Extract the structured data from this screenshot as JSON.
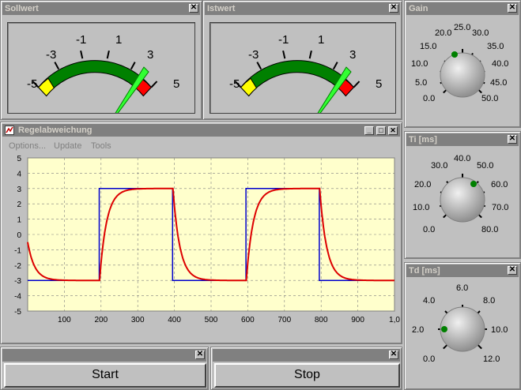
{
  "sollwert": {
    "title": "Sollwert",
    "ticks": [
      "-5",
      "-3",
      "-1",
      "1",
      "3",
      "5"
    ]
  },
  "istwert": {
    "title": "Istwert",
    "ticks": [
      "-5",
      "-3",
      "-1",
      "1",
      "3",
      "5"
    ]
  },
  "gain": {
    "title": "Gain",
    "ticks": [
      "0.0",
      "5.0",
      "10.0",
      "15.0",
      "20.0",
      "25.0",
      "30.0",
      "35.0",
      "40.0",
      "45.0",
      "50.0"
    ]
  },
  "ti": {
    "title": "Ti [ms]",
    "ticks": [
      "0.0",
      "10.0",
      "20.0",
      "30.0",
      "40.0",
      "50.0",
      "60.0",
      "70.0",
      "80.0"
    ]
  },
  "td": {
    "title": "Td [ms]",
    "ticks": [
      "0.0",
      "2.0",
      "4.0",
      "6.0",
      "8.0",
      "10.0",
      "12.0"
    ]
  },
  "regel": {
    "title": "Regelabweichung",
    "menu": [
      "Options...",
      "Update",
      "Tools"
    ]
  },
  "chart_data": {
    "type": "line",
    "xlim": [
      0,
      1000
    ],
    "ylim": [
      -5,
      5
    ],
    "x_ticks": [
      "100",
      "200",
      "300",
      "400",
      "500",
      "600",
      "700",
      "800",
      "900",
      "1,0"
    ],
    "y_ticks": [
      "5",
      "4",
      "3",
      "2",
      "1",
      "0",
      "-1",
      "-2",
      "-3",
      "-4",
      "-5"
    ],
    "grid": true,
    "series": [
      {
        "color": "#0000cc",
        "points": [
          [
            0,
            -3
          ],
          [
            195,
            -3
          ],
          [
            195,
            3
          ],
          [
            395,
            3
          ],
          [
            395,
            -3
          ],
          [
            595,
            -3
          ],
          [
            595,
            3
          ],
          [
            795,
            3
          ],
          [
            795,
            -3
          ],
          [
            1000,
            -3
          ]
        ]
      },
      {
        "color": "#dd0000",
        "shape": "first-order step response, time constant about 20"
      }
    ]
  },
  "start_button": "Start",
  "stop_button": "Stop"
}
